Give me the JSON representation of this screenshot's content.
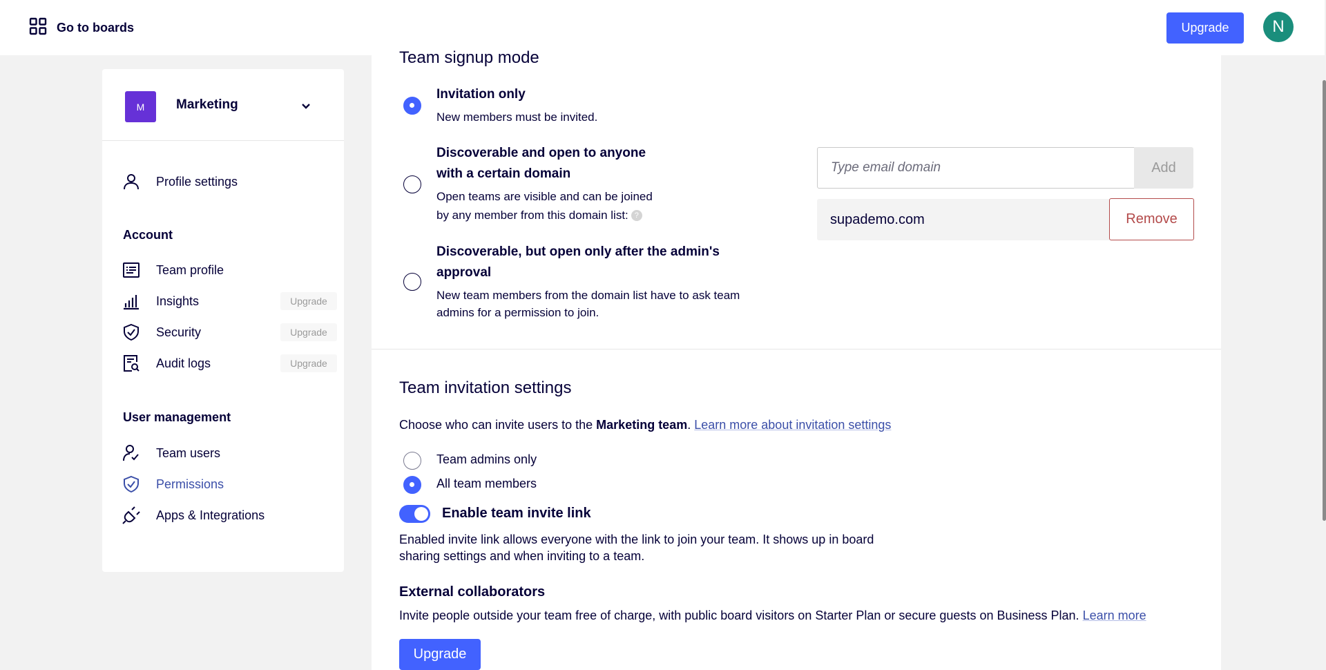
{
  "header": {
    "goto_boards_label": "Go to boards",
    "upgrade_label": "Upgrade",
    "avatar_initial": "N"
  },
  "sidebar": {
    "team": {
      "initial": "M",
      "name": "Marketing"
    },
    "profile_settings": "Profile settings",
    "account_title": "Account",
    "account_items": [
      {
        "label": "Team profile",
        "icon": "team-profile-icon"
      },
      {
        "label": "Insights",
        "icon": "insights-icon",
        "badge": "Upgrade"
      },
      {
        "label": "Security",
        "icon": "shield-icon",
        "badge": "Upgrade"
      },
      {
        "label": "Audit logs",
        "icon": "audit-logs-icon",
        "badge": "Upgrade"
      }
    ],
    "user_mgmt_title": "User management",
    "user_items": [
      {
        "label": "Team users",
        "icon": "user-check-icon"
      },
      {
        "label": "Permissions",
        "icon": "shield-check-icon",
        "active": true
      },
      {
        "label": "Apps & Integrations",
        "icon": "plug-icon"
      }
    ]
  },
  "signup": {
    "title": "Team signup mode",
    "options": [
      {
        "title": "Invitation only",
        "desc": "New members must be invited.",
        "checked": true
      },
      {
        "title_line1": "Discoverable and open to anyone",
        "title_line2": "with a certain domain",
        "desc_line1": "Open teams are visible and can be joined",
        "desc_line2": "by any member from this domain list:",
        "checked": false
      },
      {
        "title_line1": "Discoverable, but open only after the admin's",
        "title_line2": "approval",
        "desc_line1": "New team members from the domain list have to ask team",
        "desc_line2": "admins for a permission to join.",
        "checked": false
      }
    ],
    "email_placeholder": "Type email domain",
    "add_label": "Add",
    "domain": "supademo.com",
    "remove_label": "Remove"
  },
  "invitation": {
    "title": "Team invitation settings",
    "intro_prefix": "Choose who can invite users to the ",
    "intro_team": "Marketing team",
    "intro_suffix": ". ",
    "intro_link": "Learn more about invitation settings",
    "radio_admins": "Team admins only",
    "radio_all": "All team members",
    "selected": "All team members",
    "toggle_label": "Enable team invite link",
    "toggle_on": true,
    "toggle_desc_line1": "Enabled invite link allows everyone with the link to join your team. It shows up in board",
    "toggle_desc_line2": "sharing settings and when inviting to a team.",
    "external_title": "External collaborators",
    "external_desc": "Invite people outside your team free of charge, with public board visitors on Starter Plan or secure guests on Business Plan.",
    "external_link": "Learn more",
    "upgrade_label": "Upgrade"
  },
  "colors": {
    "accent": "#4262ff",
    "text": "#050038",
    "link": "#3a4ea8",
    "danger": "#b34a4a",
    "team_badge": "#6631d7",
    "avatar": "#1a8e7c"
  }
}
